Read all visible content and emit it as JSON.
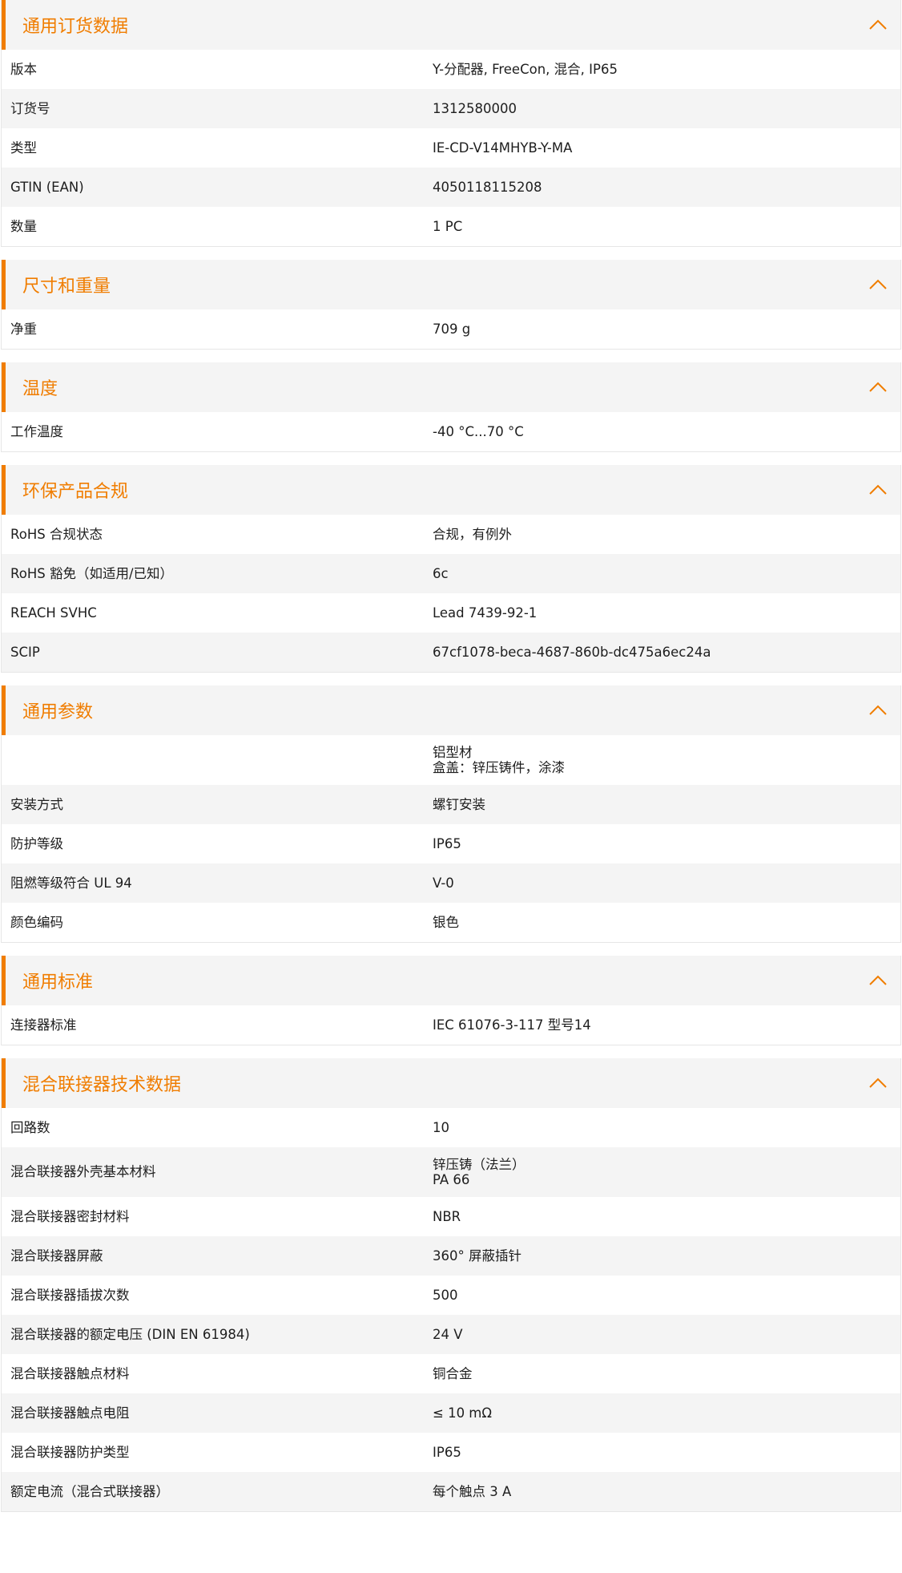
{
  "sections": [
    {
      "title": "通用订货数据",
      "rows": [
        {
          "label": "版本",
          "value": [
            "Y-分配器, FreeCon, 混合, IP65"
          ]
        },
        {
          "label": "订货号",
          "value": [
            "1312580000"
          ]
        },
        {
          "label": "类型",
          "value": [
            "IE-CD-V14MHYB-Y-MA"
          ]
        },
        {
          "label": "GTIN (EAN)",
          "value": [
            "4050118115208"
          ]
        },
        {
          "label": "数量",
          "value": [
            "1  PC"
          ]
        }
      ]
    },
    {
      "title": "尺寸和重量",
      "rows": [
        {
          "label": "净重",
          "value": [
            "709  g"
          ]
        }
      ]
    },
    {
      "title": "温度",
      "rows": [
        {
          "label": "工作温度",
          "value": [
            "-40 °C...70 °C"
          ]
        }
      ]
    },
    {
      "title": "环保产品合规",
      "rows": [
        {
          "label": "RoHS 合规状态",
          "value": [
            "合规，有例外"
          ]
        },
        {
          "label": "RoHS 豁免（如适用/已知）",
          "value": [
            "6c"
          ]
        },
        {
          "label": "REACH SVHC",
          "value": [
            "Lead 7439-92-1"
          ]
        },
        {
          "label": "SCIP",
          "value": [
            "67cf1078-beca-4687-860b-dc475a6ec24a"
          ]
        }
      ]
    },
    {
      "title": "通用参数",
      "rows": [
        {
          "label": "",
          "value": [
            "铝型材",
            "盒盖：锌压铸件，涂漆"
          ]
        },
        {
          "label": "安装方式",
          "value": [
            "螺钉安装"
          ]
        },
        {
          "label": "防护等级",
          "value": [
            "IP65"
          ]
        },
        {
          "label": "阻燃等级符合 UL 94",
          "value": [
            "V-0"
          ]
        },
        {
          "label": "颜色编码",
          "value": [
            "银色"
          ]
        }
      ]
    },
    {
      "title": "通用标准",
      "rows": [
        {
          "label": "连接器标准",
          "value": [
            "IEC 61076-3-117 型号14"
          ]
        }
      ]
    },
    {
      "title": "混合联接器技术数据",
      "rows": [
        {
          "label": "回路数",
          "value": [
            "10"
          ]
        },
        {
          "label": "混合联接器外壳基本材料",
          "value": [
            "锌压铸（法兰）",
            "PA 66"
          ]
        },
        {
          "label": "混合联接器密封材料",
          "value": [
            "NBR"
          ]
        },
        {
          "label": "混合联接器屏蔽",
          "value": [
            "360° 屏蔽插针"
          ]
        },
        {
          "label": "混合联接器插拔次数",
          "value": [
            "500"
          ]
        },
        {
          "label": "混合联接器的额定电压 (DIN EN 61984)",
          "value": [
            "24  V"
          ]
        },
        {
          "label": "混合联接器触点材料",
          "value": [
            "铜合金"
          ]
        },
        {
          "label": "混合联接器触点电阻",
          "value": [
            "≤ 10 mΩ"
          ]
        },
        {
          "label": "混合联接器防护类型",
          "value": [
            "IP65"
          ]
        },
        {
          "label": "额定电流（混合式联接器）",
          "value": [
            "每个触点 3 A"
          ]
        }
      ]
    }
  ],
  "accent_color": "#f07d00",
  "header_icon": "chevron-up-icon"
}
